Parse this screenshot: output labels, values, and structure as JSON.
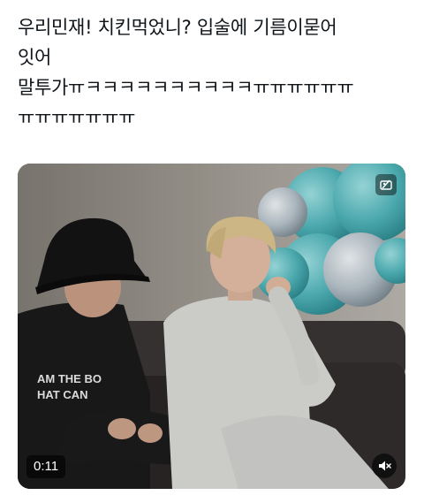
{
  "tweet": {
    "lines": [
      "우리민재! 치킨먹었니? 입술에 기름이묻어",
      "잇어",
      "말투가ㅠㅋㅋㅋㅋㅋㅋㅋㅋㅋㅋㅠㅠㅠㅠㅠㅠ",
      "ㅠㅠㅠㅠㅠㅠㅠ"
    ]
  },
  "media": {
    "shirt_text": [
      "AM THE BO",
      "HAT CAN"
    ],
    "duration": "0:11",
    "gif_badge_icon": "media-settings-icon",
    "mute_icon": "speaker-muted-icon",
    "colors": {
      "wall": "#8f8a82",
      "couch": "#2b2828",
      "balloon_teal": "#5bbcc0",
      "balloon_silver": "#b9c4cb",
      "hoodie": "#d9d9d6"
    }
  }
}
